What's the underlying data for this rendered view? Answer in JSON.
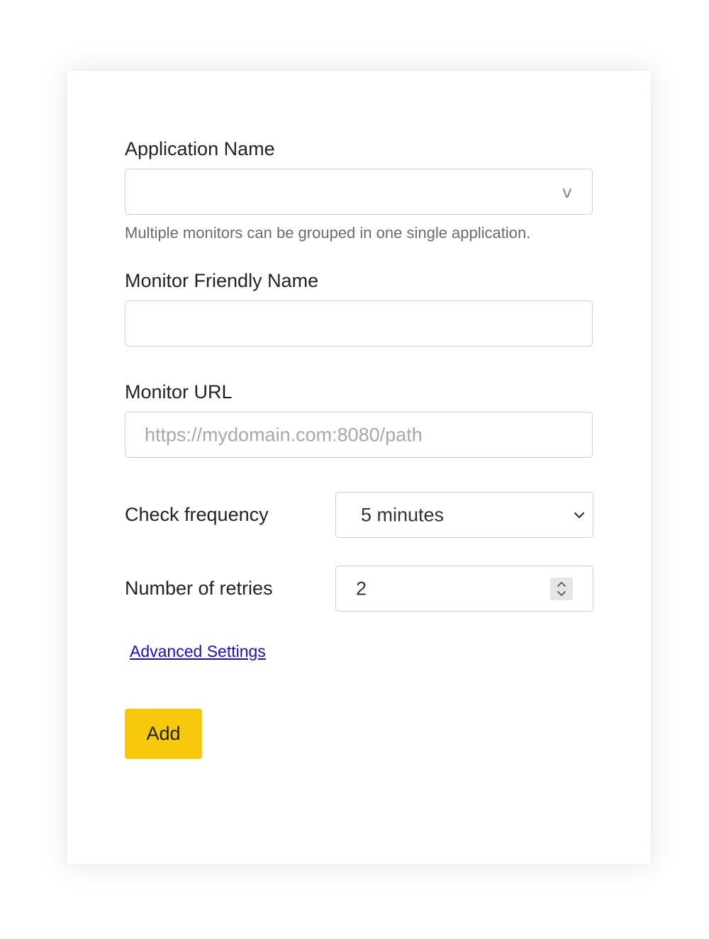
{
  "form": {
    "application_name": {
      "label": "Application Name",
      "value": "",
      "dropdown_icon": "v-chevron-icon",
      "helper": "Multiple monitors can be grouped in one single application."
    },
    "friendly_name": {
      "label": "Monitor Friendly Name",
      "value": ""
    },
    "monitor_url": {
      "label": "Monitor URL",
      "placeholder": "https://mydomain.com:8080/path"
    },
    "check_frequency": {
      "label": "Check frequency",
      "selected": "5 minutes",
      "icon": "chevron-down-icon"
    },
    "retries": {
      "label": "Number of retries",
      "value": "2",
      "icon": "spinner-arrows-icon"
    },
    "advanced_link": "Advanced Settings",
    "add_button": "Add"
  },
  "colors": {
    "accent_button": "#f8c80c",
    "link": "#1a0dcc",
    "border": "#cfcfcf"
  }
}
